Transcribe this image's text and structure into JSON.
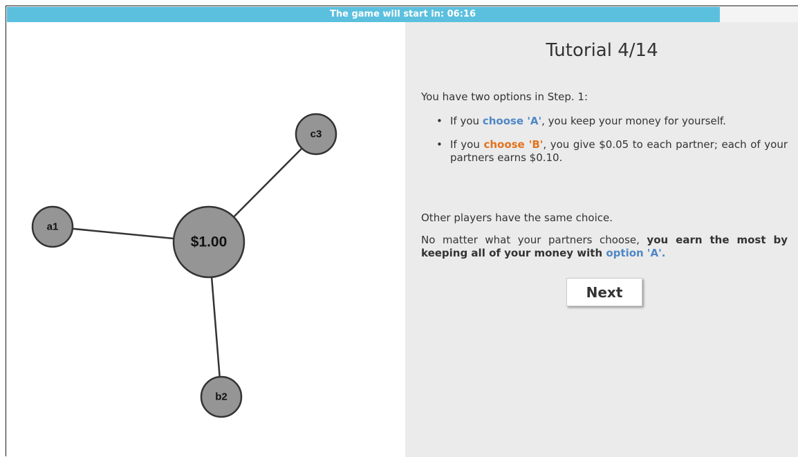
{
  "timer": {
    "text": "The game will start in: 06:16",
    "remaining_fraction": 0.9,
    "bar_color": "#5bc0de",
    "track_color": "#f4f4f4"
  },
  "network": {
    "center_node": {
      "label": "$1.00"
    },
    "nodes": [
      {
        "id": "a1",
        "label": "a1"
      },
      {
        "id": "b2",
        "label": "b2"
      },
      {
        "id": "c3",
        "label": "c3"
      }
    ],
    "node_color": "#959595"
  },
  "tutorial": {
    "title": "Tutorial 4/14",
    "intro": "You have two options in Step. 1:",
    "option_a": {
      "prefix": "If you ",
      "choice": "choose 'A'",
      "suffix": ", you keep your money for yourself."
    },
    "option_b": {
      "prefix": "If you ",
      "choice": "choose 'B'",
      "suffix": ", you give $0.05 to each partner; each of your partners earns $0.10."
    },
    "same_choice": "Other players have the same choice.",
    "advice": {
      "prefix": "No matter what your partners choose, ",
      "bold": "you earn the most by keeping all of your money with ",
      "option": "option 'A'.",
      "option_color": "#4f87c6"
    },
    "choice_b_color": "#e2721e",
    "next_label": "Next"
  }
}
